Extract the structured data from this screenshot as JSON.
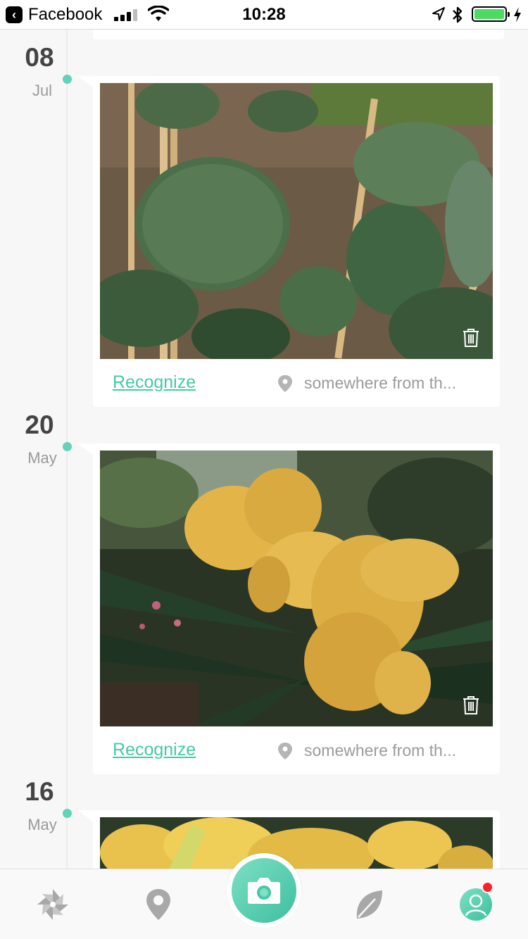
{
  "status_bar": {
    "back_app": "Facebook",
    "time": "10:28",
    "battery_color": "#4cd964"
  },
  "entries": [
    {
      "day": "08",
      "month": "Jul",
      "recognize_label": "Recognize",
      "location": "somewhere from th..."
    },
    {
      "day": "20",
      "month": "May",
      "recognize_label": "Recognize",
      "location": "somewhere from th..."
    },
    {
      "day": "16",
      "month": "May"
    }
  ],
  "tabbar": {
    "tabs": [
      "pinwheel-icon",
      "map-pin-icon",
      "camera-icon",
      "leaf-icon",
      "profile-icon"
    ],
    "accent_color": "#45c9a9",
    "notification_color": "#ff1e2a"
  }
}
